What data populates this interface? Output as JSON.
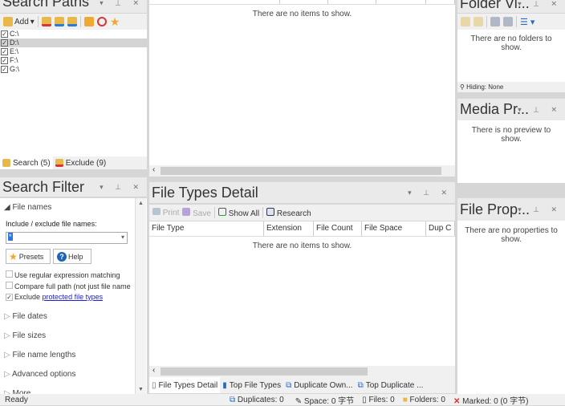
{
  "search_paths": {
    "title": "Search Paths",
    "toolbar": {
      "add": "Add"
    },
    "paths": [
      "C:\\",
      "D:\\",
      "E:\\",
      "F:\\",
      "G:\\"
    ],
    "tabs": [
      {
        "label": "Search (5)"
      },
      {
        "label": "Exclude (9)"
      }
    ]
  },
  "search_filter": {
    "title": "Search Filter",
    "file_names": "File names",
    "include_label": "Include / exclude file names:",
    "include_value": "*",
    "presets": "Presets",
    "help": "Help",
    "opt_regex": "Use regular expression matching",
    "opt_fullpath": "Compare full path (not just file name",
    "opt_exclude": "Exclude",
    "opt_exclude_link": "protected file types",
    "sections": [
      "File dates",
      "File sizes",
      "File name lengths",
      "Advanced options",
      "More"
    ]
  },
  "main_list": {
    "empty": "There are no items to show."
  },
  "file_types": {
    "title": "File Types Detail",
    "toolbar": {
      "print": "Print",
      "save": "Save",
      "show_all": "Show All",
      "research": "Research"
    },
    "columns": [
      "File Type",
      "Extension",
      "File Count",
      "File Space",
      "Dup C"
    ],
    "empty": "There are no items to show.",
    "tabs": [
      "File Types Detail",
      "Top File Types",
      "Duplicate Own...",
      "Top Duplicate ..."
    ]
  },
  "folder_view": {
    "title": "Folder Vi...",
    "empty": "There are no folders to show.",
    "hiding": "Hiding: None"
  },
  "media_preview": {
    "title": "Media Pr...",
    "empty": "There is no preview to show."
  },
  "file_props": {
    "title": "File Prop...",
    "empty": "There are no properties to show."
  },
  "status": {
    "ready": "Ready",
    "duplicates": "Duplicates: 0",
    "space": "Space: 0 字节",
    "files": "Files: 0",
    "folders": "Folders: 0",
    "marked": "Marked: 0 (0 字节)"
  }
}
